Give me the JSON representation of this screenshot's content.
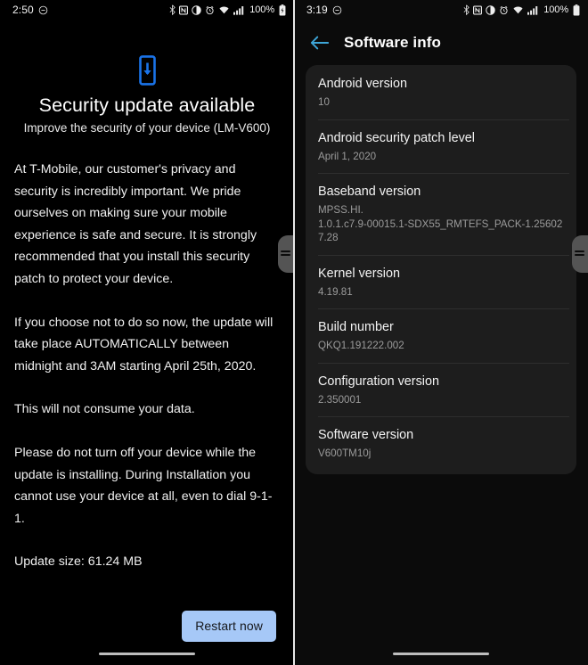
{
  "left_screen": {
    "statusbar": {
      "time": "2:50",
      "dnd_icon": "do-not-disturb-icon",
      "icons": [
        "bluetooth-icon",
        "nfc-icon",
        "contrast-icon",
        "alarm-icon",
        "wifi-icon",
        "cellular-signal-icon"
      ],
      "battery_percent": "100%",
      "battery_icon": "battery-icon"
    },
    "update_icon": "phone-download-icon",
    "headline": "Security update available",
    "subhead": "Improve the security of your device (LM-V600)",
    "paragraphs": [
      "At T-Mobile, our customer's privacy and security is incredibly important. We pride ourselves on making sure your mobile experience is safe and secure. It is strongly recommended that you install this security patch to protect your device.",
      "If you choose not to do so now, the update will take place AUTOMATICALLY between midnight and 3AM starting April 25th, 2020.",
      "This will not consume your data.",
      "Please do not turn off your device while the update is installing. During Installation you cannot use your device at all, even to dial 9-1-1."
    ],
    "update_size": "Update size: 61.24 MB",
    "restart_button": "Restart now",
    "accent_color": "#1a73e8",
    "button_color": "#a6c8f7"
  },
  "right_screen": {
    "statusbar": {
      "time": "3:19",
      "dnd_icon": "do-not-disturb-icon",
      "icons": [
        "bluetooth-icon",
        "nfc-icon",
        "contrast-icon",
        "alarm-icon",
        "wifi-icon",
        "cellular-signal-icon"
      ],
      "battery_percent": "100%",
      "battery_icon": "battery-icon"
    },
    "back_icon": "back-arrow-icon",
    "title": "Software info",
    "accent_color": "#3ea6d8",
    "rows": [
      {
        "label": "Android version",
        "value": "10"
      },
      {
        "label": "Android security patch level",
        "value": "April 1, 2020"
      },
      {
        "label": "Baseband version",
        "value": "MPSS.HI.\n1.0.1.c7.9-00015.1-SDX55_RMTEFS_PACK-1.256027.28"
      },
      {
        "label": "Kernel version",
        "value": "4.19.81"
      },
      {
        "label": "Build number",
        "value": "QKQ1.191222.002"
      },
      {
        "label": "Configuration version",
        "value": "2.350001"
      },
      {
        "label": "Software version",
        "value": "V600TM10j"
      }
    ]
  }
}
